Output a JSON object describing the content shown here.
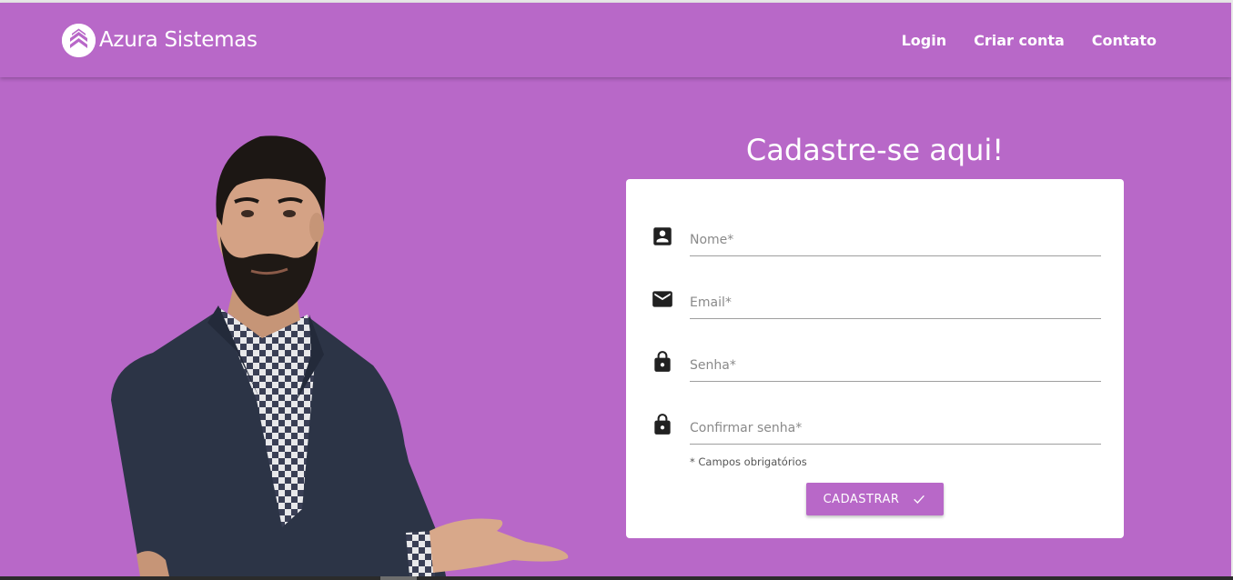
{
  "brand": {
    "name": "Azura Sistemas",
    "logo_icon": "chevrons-up-icon"
  },
  "nav": {
    "items": [
      {
        "label": "Login"
      },
      {
        "label": "Criar conta"
      },
      {
        "label": "Contato"
      }
    ]
  },
  "form": {
    "title": "Cadastre-se aqui!",
    "fields": [
      {
        "placeholder": "Nome*",
        "icon": "account-box-icon"
      },
      {
        "placeholder": "Email*",
        "icon": "email-icon"
      },
      {
        "placeholder": "Senha*",
        "icon": "lock-icon"
      },
      {
        "placeholder": "Confirmar senha*",
        "icon": "lock-icon"
      }
    ],
    "required_note": "* Campos obrigatórios",
    "submit_label": "CADASTRAR",
    "submit_icon": "check-icon"
  },
  "colors": {
    "accent": "#b868c8",
    "card": "#ffffff",
    "icon": "#212121"
  }
}
